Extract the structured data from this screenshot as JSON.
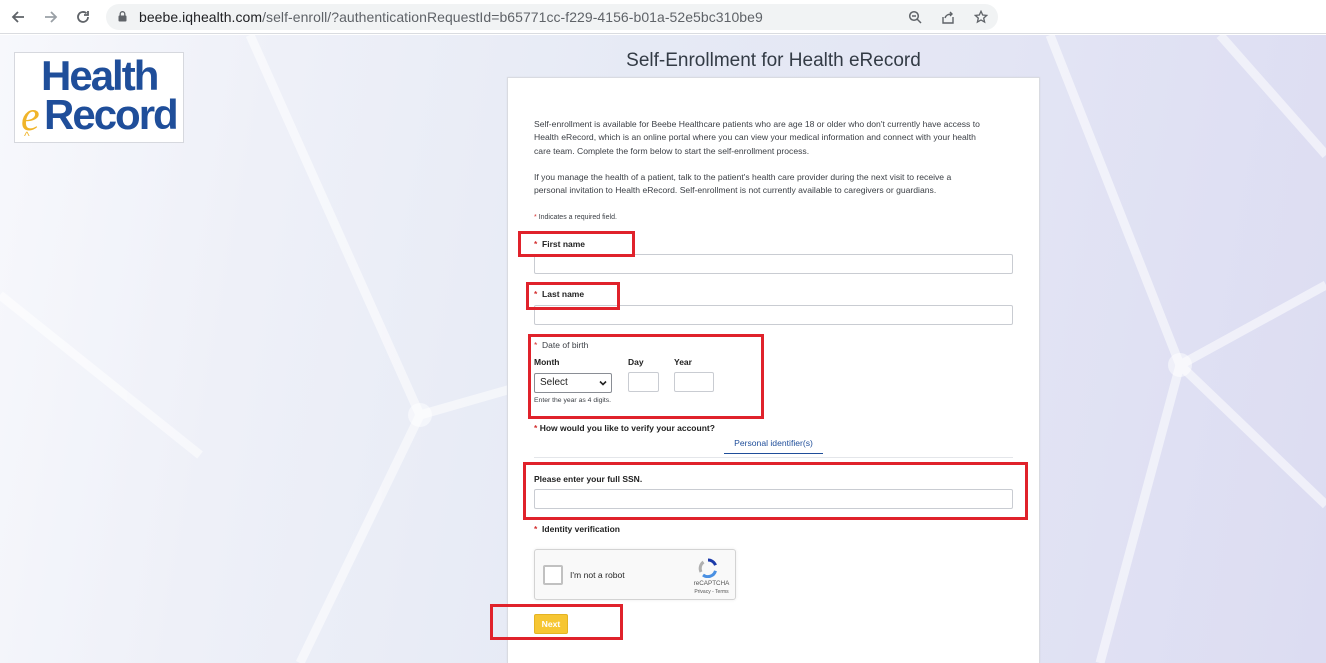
{
  "browser": {
    "url_domain": "beebe.iqhealth.com",
    "url_path": "/self-enroll/?authenticationRequestId=b65771cc-f229-4156-b01a-52e5bc310be9",
    "back_icon": "arrow-left-icon",
    "forward_icon": "arrow-right-icon",
    "reload_icon": "reload-icon",
    "lock_icon": "lock-icon",
    "zoom_icon": "zoom-icon",
    "share_icon": "share-icon",
    "bookmark_icon": "star-icon"
  },
  "logo": {
    "line1": "Health",
    "e": "e",
    "line2": "Record"
  },
  "page": {
    "title": "Self-Enrollment for Health eRecord"
  },
  "form": {
    "intro_1": "Self-enrollment is available for Beebe Healthcare patients who are age 18 or older who don't currently have access to Health eRecord, which is an online portal where you can view your medical information and connect with your health care team. Complete the form below to start the self-enrollment process.",
    "intro_2": "If you manage the health of a patient, talk to the patient's health care provider during the next visit to receive a personal invitation to Health eRecord. Self-enrollment is not currently available to caregivers or guardians.",
    "required_star": "*",
    "required_note": "Indicates a required field.",
    "first_name_label": "First name",
    "last_name_label": "Last name",
    "dob_label": "Date of birth",
    "month_label": "Month",
    "day_label": "Day",
    "year_label": "Year",
    "month_value": "Select",
    "year_hint": "Enter the year as 4 digits.",
    "verify_label": "How would you like to verify your account?",
    "verify_tab": "Personal identifier(s)",
    "ssn_label": "Please enter your full SSN.",
    "identity_label": "Identity verification",
    "captcha_text": "I'm not a robot",
    "captcha_brand": "reCAPTCHA",
    "captcha_links": "Privacy - Terms",
    "next_label": "Next"
  },
  "colors": {
    "brand_blue": "#1f4e9a",
    "brand_yellow": "#f0b429",
    "highlight_red": "#e0222b",
    "button_yellow": "#f6c633"
  }
}
